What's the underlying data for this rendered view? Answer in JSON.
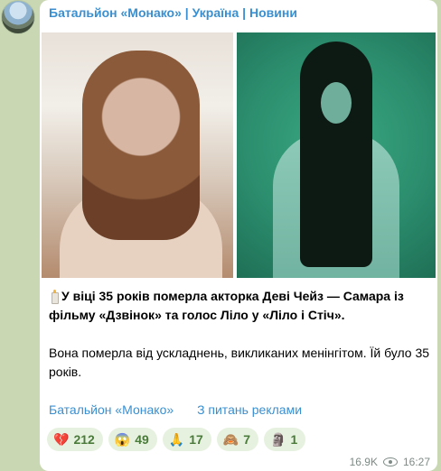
{
  "channel": {
    "name": "Батальйон «Монако» | Україна | Новини"
  },
  "post": {
    "paragraph1_icon": "candle-icon",
    "paragraph1": "У віці 35 років померла акторка Деві Чейз — Самара із фільму «Дзвінок» та голос Ліло у «Ліло і Стіч».",
    "paragraph2": "Вона померла від ускладнень, викликаних менінгітом. Їй було 35 років."
  },
  "links": {
    "channel": "Батальйон «Монако»",
    "ads": "З питань реклами"
  },
  "reactions": [
    {
      "icon": "broken-heart-icon",
      "glyph": "💔",
      "count": "212"
    },
    {
      "icon": "scream-face-icon",
      "glyph": "😱",
      "count": "49"
    },
    {
      "icon": "praying-hands-icon",
      "glyph": "🙏",
      "count": "17"
    },
    {
      "icon": "see-no-evil-monkey-icon",
      "glyph": "🙈",
      "count": "7"
    },
    {
      "icon": "moai-icon",
      "glyph": "🗿",
      "count": "1"
    }
  ],
  "meta": {
    "views": "16.9K",
    "time": "16:27"
  }
}
